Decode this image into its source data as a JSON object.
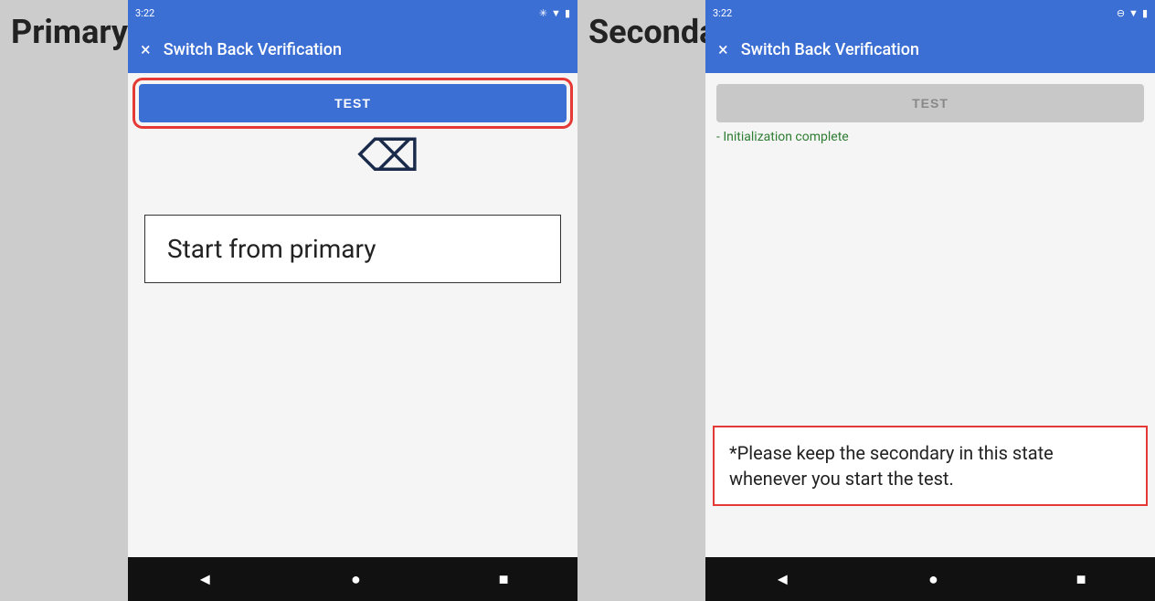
{
  "primary": {
    "label": "Primary",
    "statusBar": {
      "time": "3:22",
      "icons": "◉ ⓢ ⬛ ▶ •"
    },
    "appBar": {
      "closeLabel": "×",
      "title": "Switch Back Verification"
    },
    "testButton": "TEST",
    "startBox": "Start from primary",
    "nav": {
      "back": "◄",
      "home": "●",
      "square": "■"
    }
  },
  "secondary": {
    "label": "Secondary",
    "statusBar": {
      "time": "3:22",
      "icons": "◉ ⊖ ▼ ▮"
    },
    "appBar": {
      "closeLabel": "×",
      "title": "Switch Back Verification"
    },
    "testButton": "TEST",
    "initText": "- Initialization complete",
    "annotation": "*Please keep the secondary in this state whenever you start the test.",
    "nav": {
      "back": "◄",
      "home": "●",
      "square": "■"
    }
  }
}
